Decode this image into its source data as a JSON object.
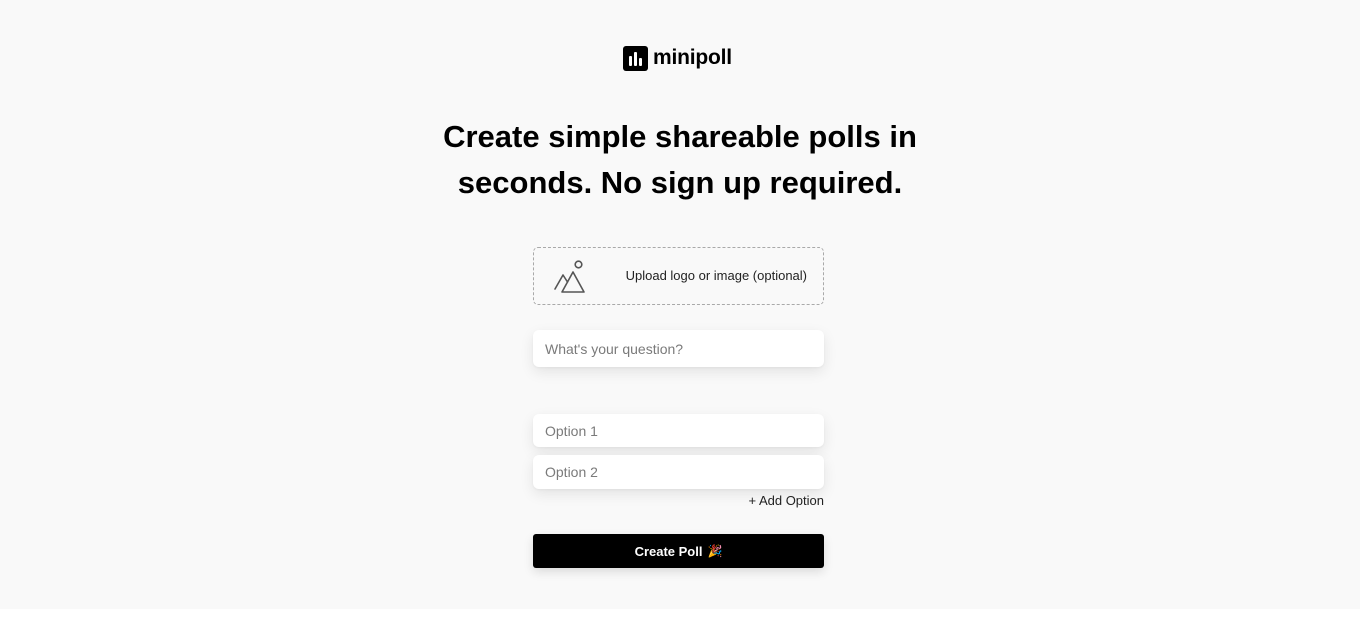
{
  "brand": {
    "name": "minipoll",
    "icon": "bar-chart-icon"
  },
  "headline": {
    "line1": "Create simple shareable polls in",
    "line2": "seconds. No sign up required."
  },
  "upload": {
    "label": "Upload logo or image (optional)",
    "icon": "image-icon"
  },
  "question": {
    "placeholder": "What's your question?",
    "value": ""
  },
  "options": [
    {
      "placeholder": "Option 1",
      "value": ""
    },
    {
      "placeholder": "Option 2",
      "value": ""
    }
  ],
  "add_option_label": "+ Add Option",
  "create_button": {
    "label": "Create Poll",
    "emoji": "🎉"
  },
  "colors": {
    "page_background": "#f9f9f9",
    "primary": "#000000",
    "button_text": "#ffffff"
  }
}
